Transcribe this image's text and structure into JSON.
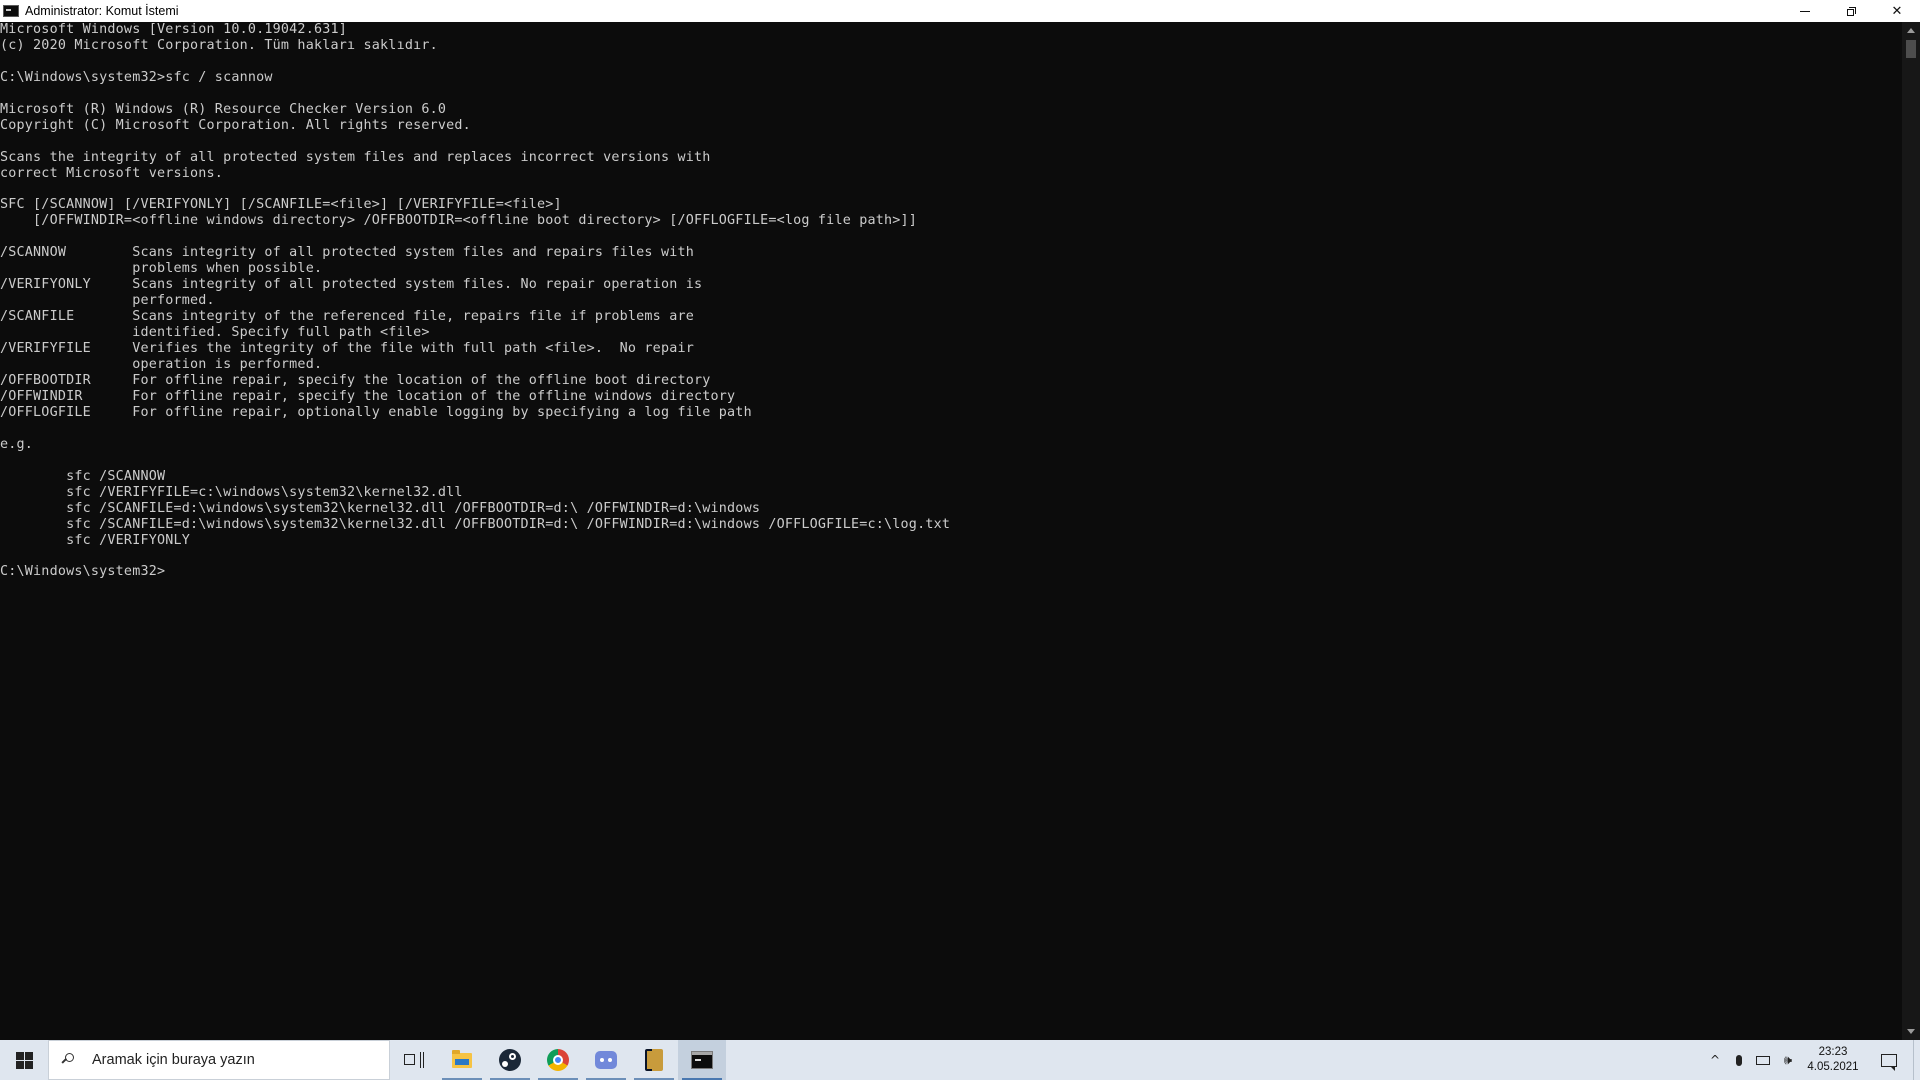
{
  "window": {
    "title": "Administrator: Komut İstemi",
    "controls": {
      "minimize": "minimize",
      "restore": "restore",
      "close": "✕"
    }
  },
  "console": {
    "lines": [
      "Microsoft Windows [Version 10.0.19042.631]",
      "(c) 2020 Microsoft Corporation. Tüm hakları saklıdır.",
      "",
      "C:\\Windows\\system32>sfc / scannow",
      "",
      "Microsoft (R) Windows (R) Resource Checker Version 6.0",
      "Copyright (C) Microsoft Corporation. All rights reserved.",
      "",
      "Scans the integrity of all protected system files and replaces incorrect versions with",
      "correct Microsoft versions.",
      "",
      "SFC [/SCANNOW] [/VERIFYONLY] [/SCANFILE=<file>] [/VERIFYFILE=<file>]",
      "    [/OFFWINDIR=<offline windows directory> /OFFBOOTDIR=<offline boot directory> [/OFFLOGFILE=<log file path>]]",
      "",
      "/SCANNOW        Scans integrity of all protected system files and repairs files with",
      "                problems when possible.",
      "/VERIFYONLY     Scans integrity of all protected system files. No repair operation is",
      "                performed.",
      "/SCANFILE       Scans integrity of the referenced file, repairs file if problems are",
      "                identified. Specify full path <file>",
      "/VERIFYFILE     Verifies the integrity of the file with full path <file>.  No repair",
      "                operation is performed.",
      "/OFFBOOTDIR     For offline repair, specify the location of the offline boot directory",
      "/OFFWINDIR      For offline repair, specify the location of the offline windows directory",
      "/OFFLOGFILE     For offline repair, optionally enable logging by specifying a log file path",
      "",
      "e.g.",
      "",
      "        sfc /SCANNOW",
      "        sfc /VERIFYFILE=c:\\windows\\system32\\kernel32.dll",
      "        sfc /SCANFILE=d:\\windows\\system32\\kernel32.dll /OFFBOOTDIR=d:\\ /OFFWINDIR=d:\\windows",
      "        sfc /SCANFILE=d:\\windows\\system32\\kernel32.dll /OFFBOOTDIR=d:\\ /OFFWINDIR=d:\\windows /OFFLOGFILE=c:\\log.txt",
      "        sfc /VERIFYONLY",
      "",
      "C:\\Windows\\system32>"
    ]
  },
  "taskbar": {
    "search_placeholder": "Aramak için buraya yazın",
    "apps": [
      {
        "name": "task-view",
        "icon": "task-view-icon",
        "running": false,
        "active": false
      },
      {
        "name": "file-explorer",
        "icon": "folder-icon",
        "running": true,
        "active": false
      },
      {
        "name": "steam",
        "icon": "steam-icon",
        "running": true,
        "active": false
      },
      {
        "name": "chrome",
        "icon": "chrome-icon",
        "running": true,
        "active": false
      },
      {
        "name": "discord",
        "icon": "discord-icon",
        "running": true,
        "active": false
      },
      {
        "name": "league-client",
        "icon": "league-icon",
        "running": true,
        "active": false
      },
      {
        "name": "command-prompt",
        "icon": "cmd-icon",
        "running": true,
        "active": true
      }
    ],
    "tray": {
      "chevron": "^",
      "volume": "🕪",
      "time": "23:23",
      "date": "4.05.2021"
    }
  }
}
